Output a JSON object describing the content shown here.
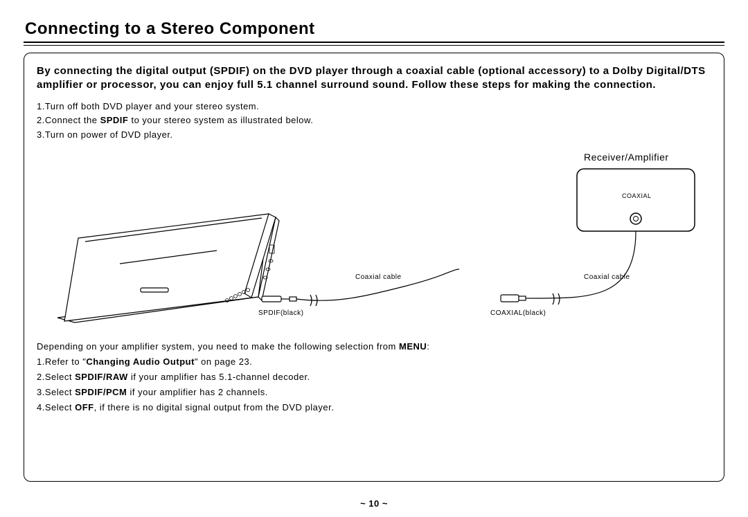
{
  "title": "Connecting to a Stereo Component",
  "intro": "By connecting the digital output (SPDIF) on the DVD player through a coaxial cable (optional accessory) to a Dolby Digital/DTS amplifier or processor, you can enjoy full 5.1 channel surround sound.  Follow these steps for making the connection.",
  "steps": {
    "s1": "1.Turn off both DVD player and your stereo system.",
    "s2a": "2.Connect the ",
    "s2b": "SPDIF",
    "s2c": " to your stereo system as illustrated below.",
    "s3": "3.Turn on power of DVD player."
  },
  "diagram": {
    "receiver_label": "Receiver/Amplifier",
    "coaxial_port": "COAXIAL",
    "coaxial_cable_left": "Coaxial cable",
    "coaxial_cable_right": "Coaxial cable",
    "spdif_black": "SPDIF(black)",
    "coaxial_black": "COAXIAL(black)"
  },
  "menu_note_a": "Depending on your amplifier system, you need to make the following selection from ",
  "menu_note_b": "MENU",
  "menu_note_c": ":",
  "menu": {
    "m1a": "1.Refer to \"",
    "m1b": "Changing Audio Output",
    "m1c": "\" on page 23.",
    "m2a": "2.Select ",
    "m2b": "SPDIF/RAW",
    "m2c": " if your amplifier has 5.1-channel decoder.",
    "m3a": "3.Select ",
    "m3b": "SPDIF/PCM",
    "m3c": " if your amplifier has 2 channels.",
    "m4a": "4.Select ",
    "m4b": "OFF",
    "m4c": ", if there is no digital signal output from the DVD player."
  },
  "page_number": "~ 10 ~"
}
